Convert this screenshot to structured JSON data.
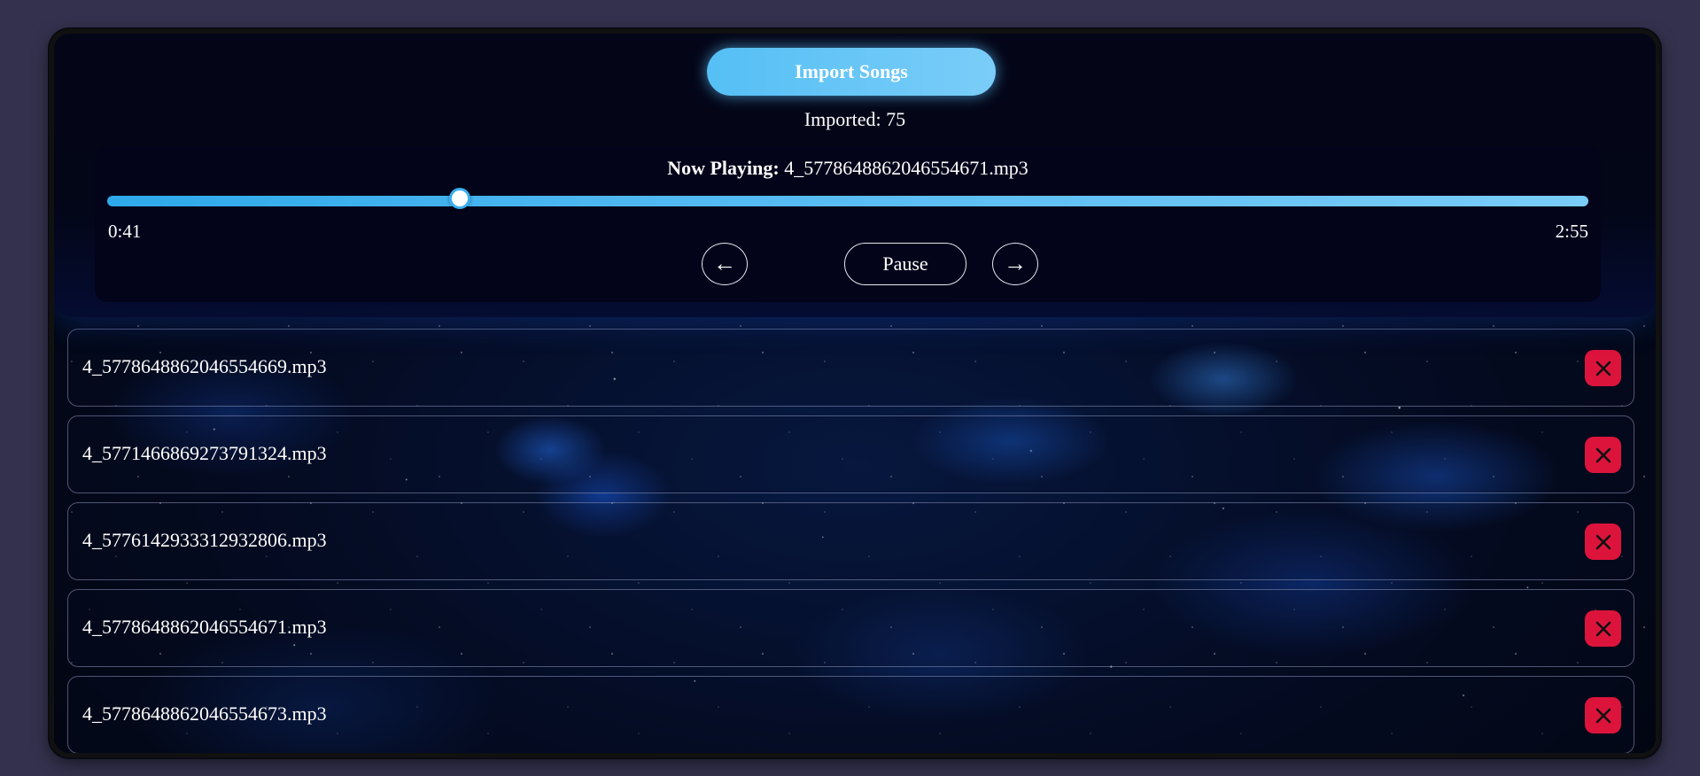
{
  "header": {
    "import_label": "Import Songs",
    "imported_label": "Imported: 75"
  },
  "player": {
    "now_playing_label": "Now Playing:",
    "now_playing_track": "4_5778648862046554671.mp3",
    "current_time": "0:41",
    "duration": "2:55",
    "progress_fraction": 0.238,
    "prev_label": "←",
    "play_label": "Pause",
    "next_label": "→"
  },
  "playlist": {
    "songs": [
      "4_5778648862046554669.mp3",
      "4_5771466869273791324.mp3",
      "4_5776142933312932806.mp3",
      "4_5778648862046554671.mp3",
      "4_5778648862046554673.mp3"
    ],
    "delete_icon": "close-icon"
  },
  "colors": {
    "accent": "#55bff5",
    "delete": "#dc143c",
    "page_bg": "#33314d"
  }
}
